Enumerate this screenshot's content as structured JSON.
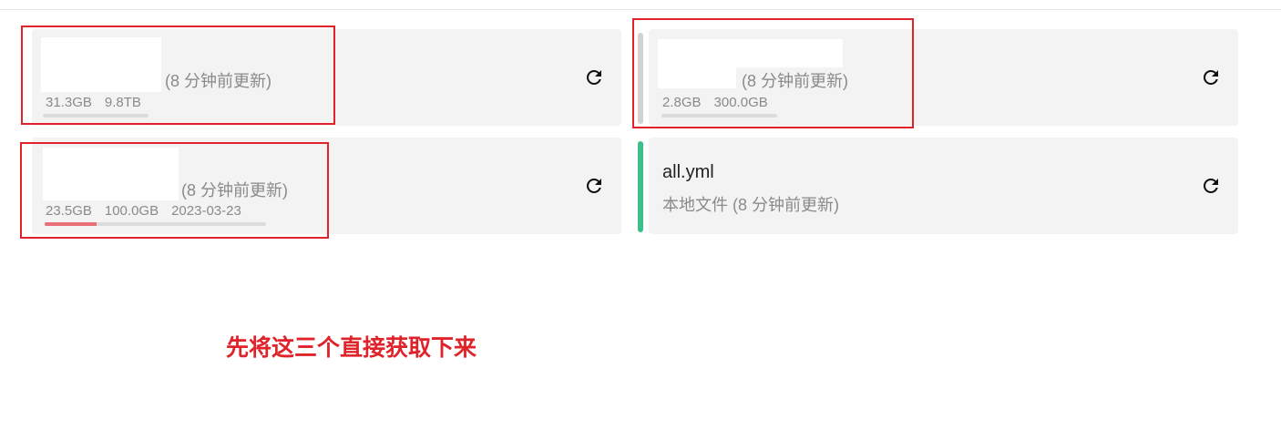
{
  "cards": [
    {
      "update_text": "(8 分钟前更新)",
      "used": "31.3GB",
      "total": "9.8TB",
      "progress_fraction": 0.0
    },
    {
      "update_text": "(8 分钟前更新)",
      "used": "2.8GB",
      "total": "300.0GB",
      "progress_fraction": 0.0
    },
    {
      "update_text": "(8 分钟前更新)",
      "used": "23.5GB",
      "total": "100.0GB",
      "expire": "2023-03-23",
      "progress_fraction": 0.235
    },
    {
      "title": "all.yml",
      "subtitle": "本地文件 (8 分钟前更新)"
    }
  ],
  "annotation": "先将这三个直接获取下来",
  "colors": {
    "card_bg": "#f3f3f3",
    "progress_fill": "#e86f78",
    "active_indicator": "#3dbf8a",
    "annotation_red": "#e0232a"
  },
  "icons": {
    "refresh": "refresh-icon"
  }
}
